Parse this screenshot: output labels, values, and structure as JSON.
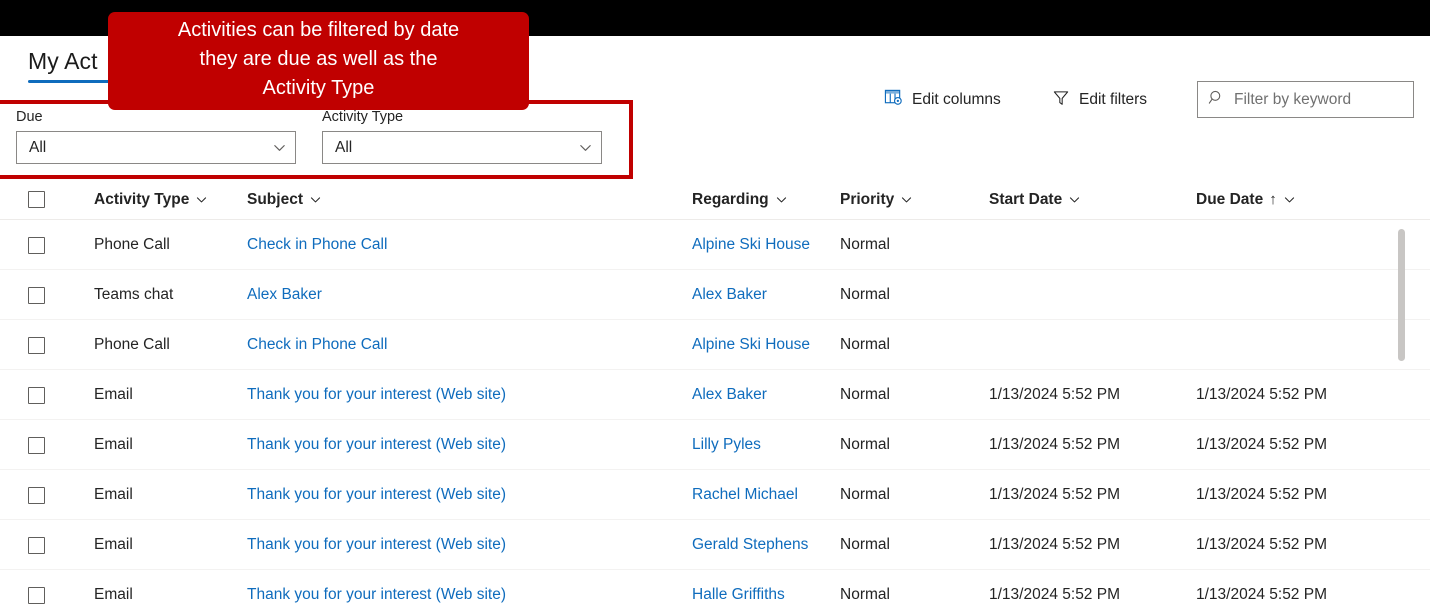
{
  "callout": {
    "text": "Activities can be filtered by date\nthey are due as well as the\nActivity Type",
    "background": "#C00000",
    "text_color": "#FFFFFF"
  },
  "highlight": {
    "color": "#C00000"
  },
  "commandbar": {
    "view_tab_label": "My Act",
    "view_tab_accent": "#0F6CBD",
    "edit_columns_label": "Edit columns",
    "edit_columns_icon": "edit-columns-icon",
    "edit_filters_label": "Edit filters",
    "edit_filters_icon": "filter-funnel-icon",
    "search": {
      "icon": "search-icon",
      "placeholder": "Filter by keyword",
      "value": ""
    }
  },
  "filters": [
    {
      "label": "Due",
      "value": "All",
      "chevron": "chevron-down-icon"
    },
    {
      "label": "Activity Type",
      "value": "All",
      "chevron": "chevron-down-icon"
    }
  ],
  "grid": {
    "select_all_checkbox": false,
    "columns": [
      {
        "key": "activity_type",
        "label": "Activity Type",
        "sorted": false,
        "sort_dir": ""
      },
      {
        "key": "subject",
        "label": "Subject",
        "sorted": false,
        "sort_dir": ""
      },
      {
        "key": "regarding",
        "label": "Regarding",
        "sorted": false,
        "sort_dir": ""
      },
      {
        "key": "priority",
        "label": "Priority",
        "sorted": false,
        "sort_dir": ""
      },
      {
        "key": "start_date",
        "label": "Start Date",
        "sorted": false,
        "sort_dir": ""
      },
      {
        "key": "due_date",
        "label": "Due Date",
        "sorted": true,
        "sort_dir": "↑"
      }
    ],
    "rows": [
      {
        "selected": false,
        "activity_type": "Phone Call",
        "subject": "Check in Phone Call",
        "regarding": "Alpine Ski House",
        "priority": "Normal",
        "start_date": "",
        "due_date": ""
      },
      {
        "selected": false,
        "activity_type": "Teams chat",
        "subject": "Alex Baker",
        "regarding": "Alex Baker",
        "priority": "Normal",
        "start_date": "",
        "due_date": ""
      },
      {
        "selected": false,
        "activity_type": "Phone Call",
        "subject": "Check in Phone Call",
        "regarding": "Alpine Ski House",
        "priority": "Normal",
        "start_date": "",
        "due_date": ""
      },
      {
        "selected": false,
        "activity_type": "Email",
        "subject": "Thank you for your interest (Web site)",
        "regarding": "Alex Baker",
        "priority": "Normal",
        "start_date": "1/13/2024 5:52 PM",
        "due_date": "1/13/2024 5:52 PM"
      },
      {
        "selected": false,
        "activity_type": "Email",
        "subject": "Thank you for your interest (Web site)",
        "regarding": "Lilly Pyles",
        "priority": "Normal",
        "start_date": "1/13/2024 5:52 PM",
        "due_date": "1/13/2024 5:52 PM"
      },
      {
        "selected": false,
        "activity_type": "Email",
        "subject": "Thank you for your interest (Web site)",
        "regarding": "Rachel Michael",
        "priority": "Normal",
        "start_date": "1/13/2024 5:52 PM",
        "due_date": "1/13/2024 5:52 PM"
      },
      {
        "selected": false,
        "activity_type": "Email",
        "subject": "Thank you for your interest (Web site)",
        "regarding": "Gerald Stephens",
        "priority": "Normal",
        "start_date": "1/13/2024 5:52 PM",
        "due_date": "1/13/2024 5:52 PM"
      },
      {
        "selected": false,
        "activity_type": "Email",
        "subject": "Thank you for your interest (Web site)",
        "regarding": "Halle Griffiths",
        "priority": "Normal",
        "start_date": "1/13/2024 5:52 PM",
        "due_date": "1/13/2024 5:52 PM"
      }
    ]
  }
}
